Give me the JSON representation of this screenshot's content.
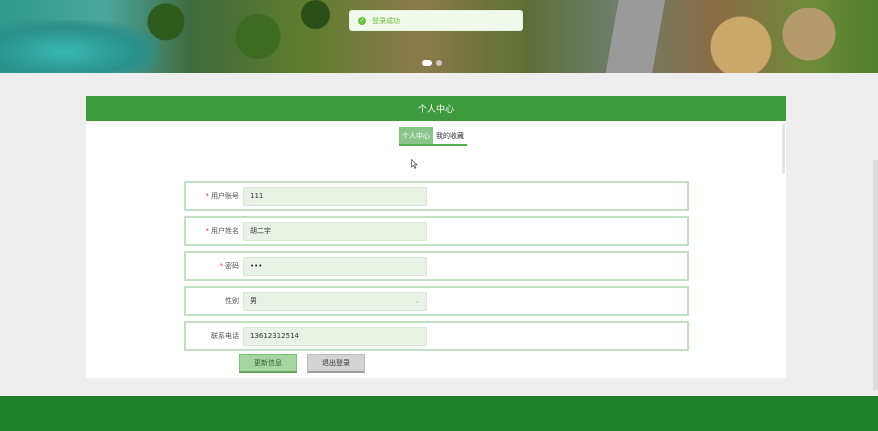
{
  "toast": {
    "message": "登录成功"
  },
  "panel": {
    "title": "个人中心"
  },
  "tabs": [
    {
      "label": "个人中心",
      "active": true
    },
    {
      "label": "我的收藏",
      "active": false
    }
  ],
  "form": {
    "fields": [
      {
        "label": "用户账号",
        "required": true,
        "value": "111"
      },
      {
        "label": "用户姓名",
        "required": true,
        "value": "胡二宇"
      },
      {
        "label": "密码",
        "required": true,
        "value": "•••"
      },
      {
        "label": "性别",
        "required": false,
        "value": "男"
      },
      {
        "label": "联系电话",
        "required": false,
        "value": "13612312514"
      }
    ],
    "required_mark": "*"
  },
  "buttons": {
    "update": "更新信息",
    "logout": "退出登录"
  },
  "colors": {
    "primary": "#3d9a3d",
    "footer": "#1f7f2b",
    "toast_text": "#67c23a"
  },
  "icons": {
    "toast": "check-circle-icon",
    "select": "chevron-down-icon",
    "cursor": "mouse-pointer-icon"
  }
}
